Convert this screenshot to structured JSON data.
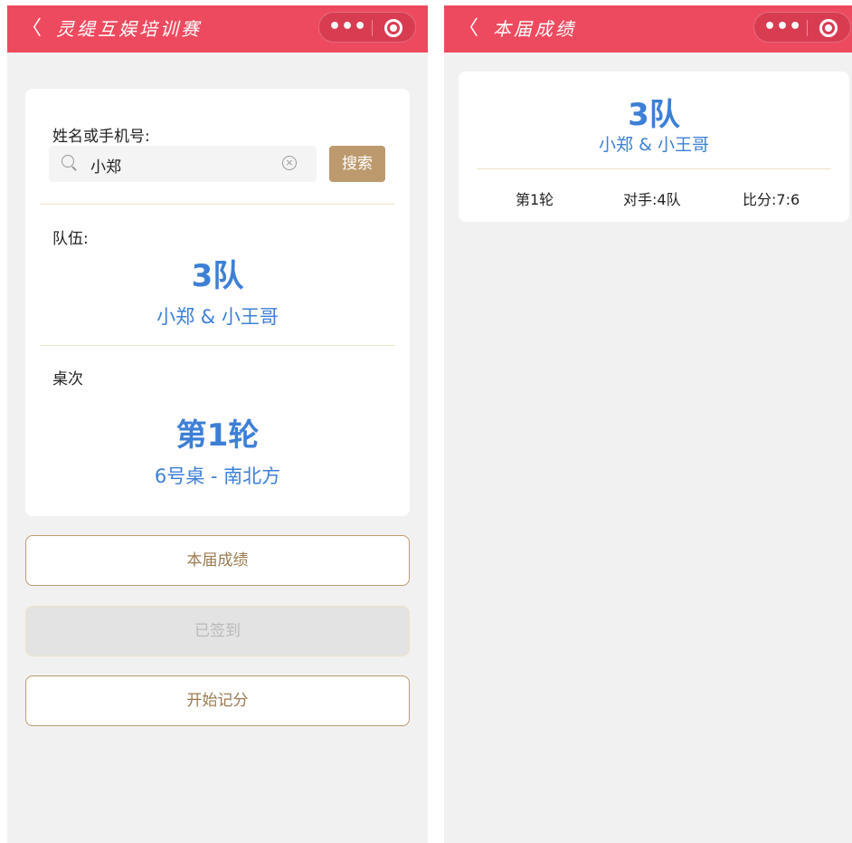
{
  "left": {
    "nav": {
      "back": "〈",
      "title": "灵缇互娱培训赛",
      "more": "•••"
    },
    "search": {
      "label": "姓名或手机号:",
      "value": "小郑",
      "clear": "×",
      "button": "搜索"
    },
    "team": {
      "label": "队伍:",
      "name": "3队",
      "members": "小郑 & 小王哥"
    },
    "table": {
      "label": "桌次",
      "round": "第1轮",
      "seat": "6号桌 - 南北方"
    },
    "buttons": {
      "results": "本届成绩",
      "signed": "已签到",
      "start": "开始记分"
    }
  },
  "right": {
    "nav": {
      "back": "〈",
      "title": "本届成绩",
      "more": "•••"
    },
    "result": {
      "team": "3队",
      "members": "小郑 & 小王哥",
      "round": "第1轮",
      "opponent": "对手:4队",
      "score": "比分:7:6"
    }
  },
  "colors": {
    "nav": "#ee4a5f",
    "accent_gold": "#bd9a6d",
    "team_blue": "#3d7fd6",
    "background": "#f1f1f1"
  }
}
